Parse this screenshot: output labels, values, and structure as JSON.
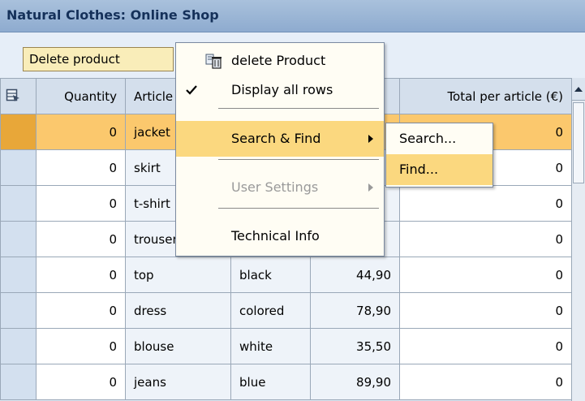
{
  "title": "Natural Clothes: Online Shop",
  "toolbar": {
    "delete_label": "Delete product"
  },
  "table": {
    "headers": {
      "quantity": "Quantity",
      "article": "Article",
      "color": "",
      "price": "",
      "total": "Total per article (€)"
    },
    "rows": [
      {
        "quantity": "0",
        "article": "jacket",
        "color": "",
        "price": "",
        "total": "0"
      },
      {
        "quantity": "0",
        "article": "skirt",
        "color": "",
        "price": "",
        "total": "0"
      },
      {
        "quantity": "0",
        "article": "t-shirt",
        "color": "",
        "price": "",
        "total": "0"
      },
      {
        "quantity": "0",
        "article": "trousers",
        "color": "",
        "price": "",
        "total": "0"
      },
      {
        "quantity": "0",
        "article": "top",
        "color": "black",
        "price": "44,90",
        "total": "0"
      },
      {
        "quantity": "0",
        "article": "dress",
        "color": "colored",
        "price": "78,90",
        "total": "0"
      },
      {
        "quantity": "0",
        "article": "blouse",
        "color": "white",
        "price": "35,50",
        "total": "0"
      },
      {
        "quantity": "0",
        "article": "jeans",
        "color": "blue",
        "price": "89,90",
        "total": "0"
      }
    ]
  },
  "context_menu": {
    "delete": "delete Product",
    "display_all": "Display all rows",
    "search_find": "Search & Find",
    "user_settings": "User Settings",
    "technical_info": "Technical Info"
  },
  "submenu": {
    "search": "Search...",
    "find": "Find..."
  },
  "icons": {
    "row_selector": "select-all-icon",
    "delete": "trash-icon",
    "check": "checkmark-icon",
    "submenu": "chevron-right-icon"
  },
  "colors": {
    "highlight_row": "#fbc86d",
    "menu_hover": "#fbd87f",
    "button": "#f9edb9",
    "title_bar": "#a9c1dc"
  }
}
